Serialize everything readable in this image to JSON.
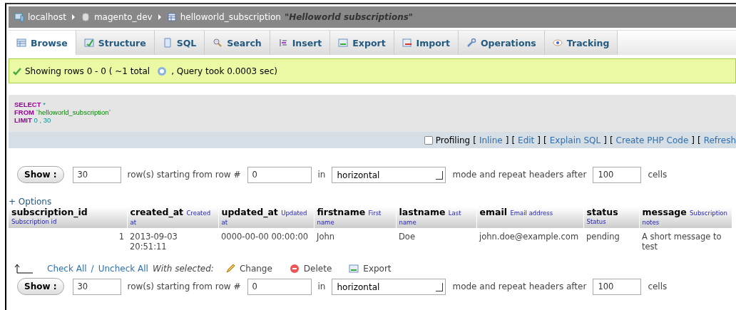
{
  "breadcrumb": {
    "items": [
      {
        "kind": "server",
        "label": "localhost"
      },
      {
        "kind": "database",
        "label": "magento_dev"
      },
      {
        "kind": "table",
        "label": "helloworld_subscription"
      }
    ],
    "comment": "\"Helloworld subscriptions\""
  },
  "tabs": [
    {
      "kind": "browse",
      "label": "Browse",
      "selected": true
    },
    {
      "kind": "structure",
      "label": "Structure",
      "selected": false
    },
    {
      "kind": "sql",
      "label": "SQL",
      "selected": false
    },
    {
      "kind": "search",
      "label": "Search",
      "selected": false
    },
    {
      "kind": "insert",
      "label": "Insert",
      "selected": false
    },
    {
      "kind": "export",
      "label": "Export",
      "selected": false
    },
    {
      "kind": "import",
      "label": "Import",
      "selected": false
    },
    {
      "kind": "operations",
      "label": "Operations",
      "selected": false
    },
    {
      "kind": "tracking",
      "label": "Tracking",
      "selected": false
    }
  ],
  "message": {
    "before": "Showing rows 0 - 0 ( ~1 total",
    "after": ", Query took 0.0003 sec)"
  },
  "sql": [
    {
      "keyword": "SELECT",
      "rest": "*"
    },
    {
      "keyword": "FROM",
      "rest": "`helloworld_subscription`"
    },
    {
      "keyword": "LIMIT",
      "rest": "0 , 30"
    }
  ],
  "profiling": {
    "checked": false,
    "label": "Profiling",
    "links": [
      {
        "open": "[",
        "label": "Inline",
        "close": "]"
      },
      {
        "open": "[",
        "label": "Edit",
        "close": "]"
      },
      {
        "open": "[",
        "label": "Explain SQL",
        "close": "]"
      },
      {
        "open": "[",
        "label": "Create PHP Code",
        "close": "]"
      },
      {
        "open": "[",
        "label": "Refresh"
      }
    ]
  },
  "navigation": [
    {
      "button": "Show :",
      "rows": "30",
      "starting_text": "row(s) starting from row #",
      "start": "0",
      "in_text": "in",
      "mode": "horizontal",
      "repeat_text": "mode and repeat headers after",
      "repeat": "100",
      "cells_text": "cells"
    },
    {
      "button": "Show :",
      "rows": "30",
      "starting_text": "row(s) starting from row #",
      "start": "0",
      "in_text": "in",
      "mode": "horizontal",
      "repeat_text": "mode and repeat headers after",
      "repeat": "100",
      "cells_text": "cells"
    }
  ],
  "options_link": "+ Options",
  "table": {
    "columns": [
      {
        "name": "subscription_id",
        "comment": "Subscription id"
      },
      {
        "name": "created_at",
        "comment": "Created at"
      },
      {
        "name": "updated_at",
        "comment": "Updated at"
      },
      {
        "name": "firstname",
        "comment": "First name"
      },
      {
        "name": "lastname",
        "comment": "Last name"
      },
      {
        "name": "email",
        "comment": "Email address"
      },
      {
        "name": "status",
        "comment": "Status"
      },
      {
        "name": "message",
        "comment": "Subscription notes"
      }
    ],
    "rows": [
      [
        "1",
        "2013-09-03 20:51:11",
        "0000-00-00 00:00:00",
        "John",
        "Doe",
        "john.doe@example.com",
        "pending",
        "A short message to test"
      ]
    ]
  },
  "bulk": {
    "check_all": "Check All",
    "separator": "/",
    "uncheck_all": "Uncheck All",
    "with_selected": "With selected:",
    "actions": [
      {
        "kind": "change",
        "label": "Change"
      },
      {
        "kind": "delete",
        "label": "Delete"
      },
      {
        "kind": "export",
        "label": "Export"
      }
    ]
  }
}
